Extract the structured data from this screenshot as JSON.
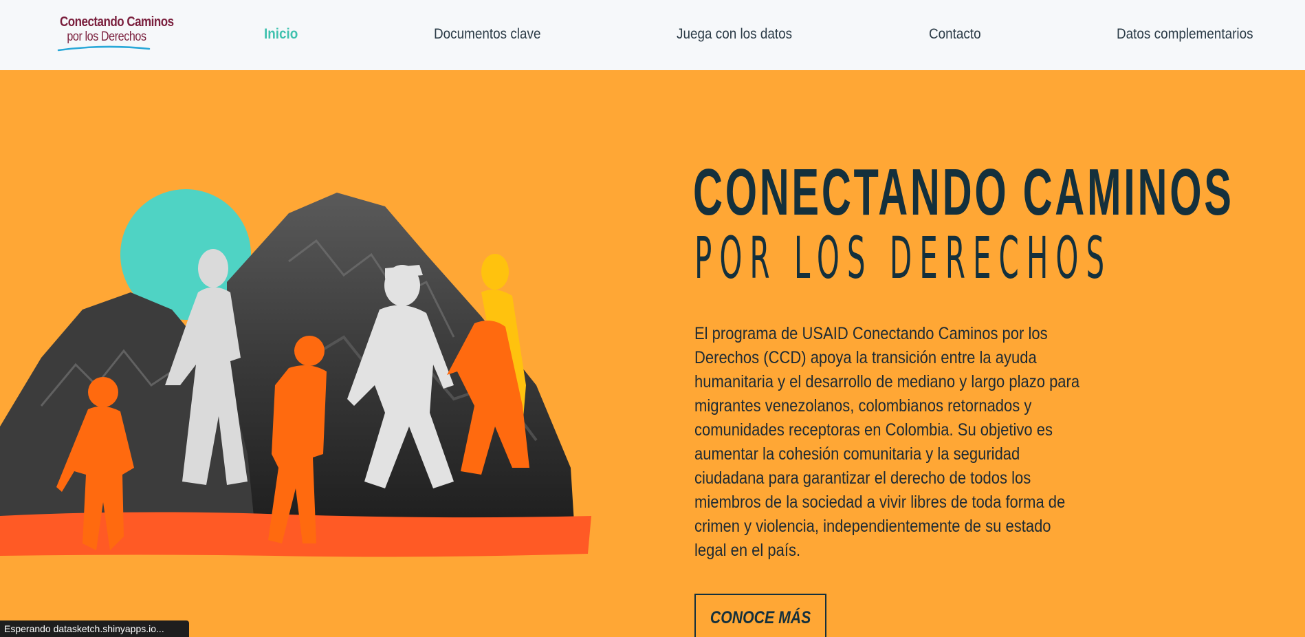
{
  "logo": {
    "line1": "Conectando Caminos",
    "line2": "por los Derechos"
  },
  "nav": {
    "items": [
      {
        "label": "Inicio",
        "active": true
      },
      {
        "label": "Documentos clave",
        "active": false
      },
      {
        "label": "Juega con los datos",
        "active": false
      },
      {
        "label": "Contacto",
        "active": false
      },
      {
        "label": "Datos complementarios",
        "active": false
      }
    ]
  },
  "hero": {
    "title_line1": "CONECTANDO CAMINOS",
    "title_line2": "POR LOS DERECHOS",
    "description": "El programa de USAID Conectando Caminos por los Derechos (CCD) apoya la transición entre la ayuda humanitaria y el desarrollo de mediano y largo plazo para migrantes venezolanos, colombianos retornados y comunidades receptoras en Colombia. Su objetivo es aumentar la cohesión comunitaria y la seguridad ciudadana para garantizar el derecho de todos los miembros de la sociedad a vivir libres de toda forma de crimen y violencia, independientemente de su estado legal en el país.",
    "cta_label": "CONOCE MÁS"
  },
  "status_bar": {
    "text": "Esperando datasketch.shinyapps.io..."
  },
  "colors": {
    "background": "#FFA735",
    "navbar": "#F6F8FA",
    "accent": "#3FC1AE",
    "title": "#14303C",
    "logo": "#7A1F3D"
  }
}
